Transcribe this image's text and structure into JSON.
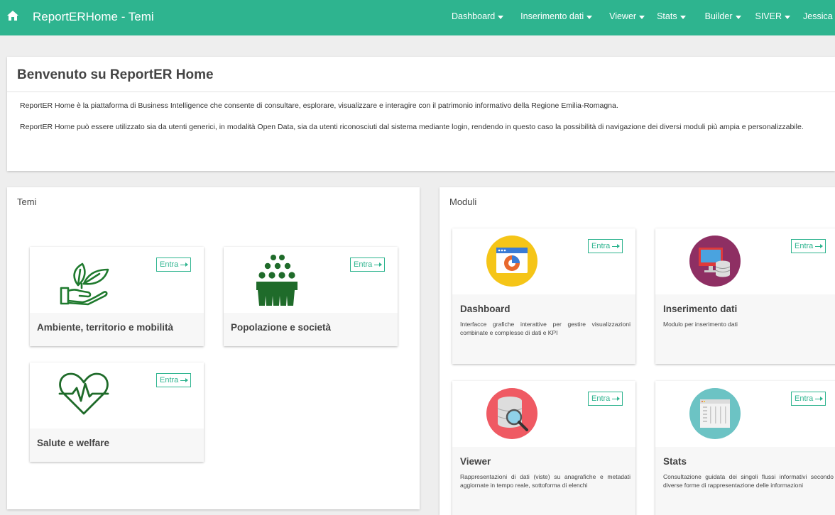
{
  "navbar": {
    "brand": "ReportERHome - Temi",
    "items": [
      {
        "label": "Dashboard"
      },
      {
        "label": "Inserimento dati"
      },
      {
        "label": "Viewer"
      },
      {
        "label": "Stats"
      },
      {
        "label": "Builder"
      },
      {
        "label": "SIVER"
      },
      {
        "label": "Jessica"
      }
    ],
    "color": "#2eb48f"
  },
  "welcome": {
    "title": "Benvenuto su ReportER Home",
    "paragraph1": "ReportER Home è la piattaforma di Business Intelligence che consente di consultare, esplorare, visualizzare e interagire con il patrimonio informativo della Regione Emilia-Romagna.",
    "paragraph2": "ReportER Home può essere utilizzato sia da utenti generici, in modalità Open Data, sia da utenti riconosciuti dal sistema mediante login, rendendo in questo caso la possibilità di navigazione dei diversi moduli più ampia e personalizzabile."
  },
  "temi": {
    "title": "Temi",
    "cards": [
      {
        "label": "Ambiente, territorio e mobilità",
        "icon": "plant-hand-icon",
        "button": "Entra"
      },
      {
        "label": "Popolazione e società",
        "icon": "people-group-icon",
        "button": "Entra"
      },
      {
        "label": "Salute e welfare",
        "icon": "heart-pulse-icon",
        "button": "Entra"
      }
    ]
  },
  "moduli": {
    "title": "Moduli",
    "cards": [
      {
        "title": "Dashboard",
        "description": "Interfacce grafiche interattive per gestire visualizzazioni combinate e complesse di dati e KPI",
        "icon": "dashboard-window-icon",
        "button": "Entra",
        "icon_color": "#f5c518"
      },
      {
        "title": "Inserimento dati",
        "description": "Modulo per inserimento dati",
        "icon": "monitor-database-icon",
        "button": "Entra",
        "icon_color": "#8e2f63"
      },
      {
        "title": "Viewer",
        "description": "Rappresentazioni di dati (viste) su anagrafiche e metadati aggiornate in tempo reale, sottoforma di elenchi",
        "icon": "database-magnifier-icon",
        "button": "Entra",
        "icon_color": "#ef5a63"
      },
      {
        "title": "Stats",
        "description": "Consultazione guidata dei singoli flussi informativi secondo diverse forme di rappresentazione delle informazioni",
        "icon": "stats-window-icon",
        "button": "Entra",
        "icon_color": "#6cc3c4"
      }
    ]
  }
}
